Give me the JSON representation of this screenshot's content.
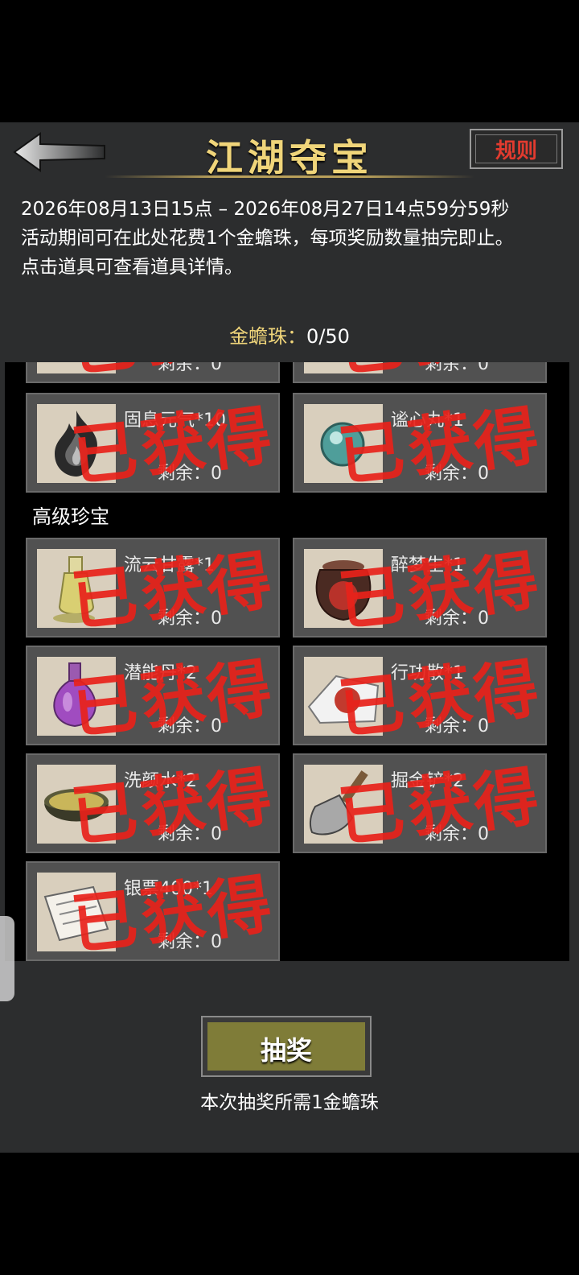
{
  "header": {
    "title": "江湖夺宝",
    "rules_label": "规则"
  },
  "description": {
    "line1": "2026年08月13日15点 – 2026年08月27日14点59分59秒",
    "line2": "活动期间可在此处花费1个金蟾珠，每项奖励数量抽完即止。",
    "line3": "点击道具可查看道具详情。"
  },
  "currency": {
    "label": "金蟾珠：",
    "value": "0/50"
  },
  "stamp_text": "已获得",
  "remaining_label": "剩余：",
  "partial_row": {
    "left_remaining": "0",
    "right_remaining": "0"
  },
  "basic_items": [
    {
      "name": "固息元气*10",
      "remaining": "0",
      "icon": "flame-spirit-icon"
    },
    {
      "name": "谧心丸*1",
      "remaining": "0",
      "icon": "jade-pearl-icon"
    }
  ],
  "section_title": "高级珍宝",
  "advanced_items": [
    {
      "name": "流云甘露*1",
      "remaining": "0",
      "icon": "wine-flask-icon"
    },
    {
      "name": "醉梦生*1",
      "remaining": "0",
      "icon": "wine-jar-icon"
    },
    {
      "name": "潜能丹*2",
      "remaining": "0",
      "icon": "potion-bottle-icon"
    },
    {
      "name": "行功散*1",
      "remaining": "0",
      "icon": "powder-packet-icon"
    },
    {
      "name": "洗颜水*2",
      "remaining": "0",
      "icon": "water-bowl-icon"
    },
    {
      "name": "掘金铲*2",
      "remaining": "0",
      "icon": "shovel-icon"
    },
    {
      "name": "银票400*1",
      "remaining": "0",
      "icon": "banknote-icon"
    }
  ],
  "draw": {
    "button_label": "抽奖",
    "cost_text": "本次抽奖所需1金蟾珠"
  },
  "colors": {
    "title_gold": "#f0d57a",
    "stamp_red": "#e8221a",
    "draw_button": "#7f7c38"
  }
}
